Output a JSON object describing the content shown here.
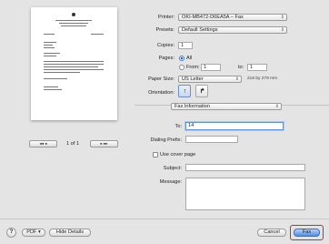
{
  "preview": {
    "page_indicator": "1 of 1",
    "nav_left_label": "◂◂ ◂",
    "nav_right_label": "▸ ▸▸"
  },
  "printer": {
    "label": "Printer:",
    "value": "OKI-MB472-D6EA5A – Fax"
  },
  "presets": {
    "label": "Presets:",
    "value": "Default Settings"
  },
  "copies": {
    "label": "Copies:",
    "value": "1"
  },
  "pages": {
    "label": "Pages:",
    "all_label": "All",
    "from_label": "From:",
    "from_value": "1",
    "to_label": "to:",
    "to_value": "1"
  },
  "paper_size": {
    "label": "Paper Size:",
    "value": "US Letter",
    "dimensions": "216 by 279 mm"
  },
  "orientation": {
    "label": "Orientation:"
  },
  "section_menu": {
    "value": "Fax Information"
  },
  "fax": {
    "to_label": "To:",
    "to_value": "14",
    "dialing_prefix_label": "Dialing Prefix:",
    "dialing_prefix_value": "",
    "use_cover_page_label": "Use cover page",
    "subject_label": "Subject:",
    "subject_value": "",
    "message_label": "Message:",
    "message_value": ""
  },
  "footer": {
    "help_label": "?",
    "pdf_label": "PDF ▾",
    "hide_details_label": "Hide Details",
    "cancel_label": "Cancel",
    "fax_label": "Fax"
  },
  "colors": {
    "accent": "#2a6bd1",
    "highlight_ring": "#d9272e",
    "window_bg": "#e4e4e4"
  }
}
